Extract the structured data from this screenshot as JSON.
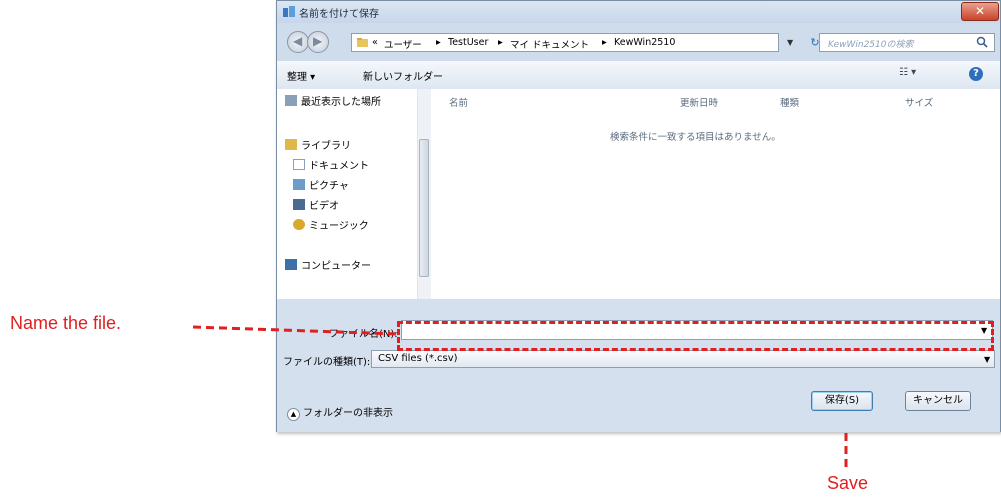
{
  "dialog": {
    "title": "名前を付けて保存",
    "close_label": "✕"
  },
  "address": {
    "crumbs": [
      "«",
      "ユーザー",
      "▸",
      "TestUser",
      "▸",
      "マイ ドキュメント",
      "▸",
      "KewWin2510"
    ],
    "search_placeholder": "KewWin2510の検索"
  },
  "toolbar": {
    "organize_label": "整理 ▾",
    "new_folder_label": "新しいフォルダー",
    "view_label": "☷ ▾",
    "help_label": "?"
  },
  "nav_pane": {
    "items": [
      {
        "label": "最近表示した場所",
        "icon": "recent-places-icon"
      },
      {
        "label": "ライブラリ",
        "icon": "library-icon"
      },
      {
        "label": "ドキュメント",
        "icon": "documents-icon"
      },
      {
        "label": "ピクチャ",
        "icon": "pictures-icon"
      },
      {
        "label": "ビデオ",
        "icon": "videos-icon"
      },
      {
        "label": "ミュージック",
        "icon": "music-icon"
      },
      {
        "label": "コンピューター",
        "icon": "computer-icon"
      }
    ]
  },
  "file_list": {
    "columns": [
      "名前",
      "更新日時",
      "種類",
      "サイズ"
    ],
    "empty_message": "検索条件に一致する項目はありません。"
  },
  "form": {
    "filename_label": "ファイル名(N):",
    "filename_value": "",
    "filetype_label": "ファイルの種類(T):",
    "filetype_value": "CSV files (*.csv)",
    "hide_folders_label": "フォルダーの非表示",
    "save_label": "保存(S)",
    "cancel_label": "キャンセル"
  },
  "annotations": {
    "name_hint": "Name the file.",
    "save_hint": "Save",
    "color": "#e02020"
  }
}
